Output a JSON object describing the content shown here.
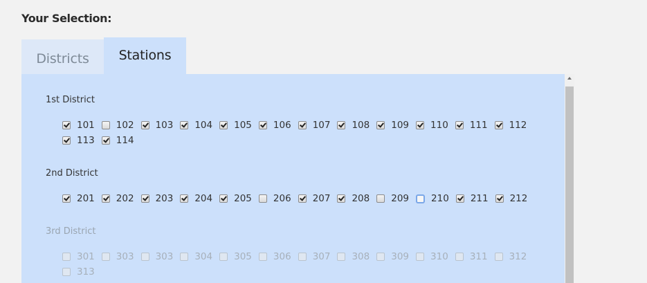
{
  "heading": "Your Selection:",
  "tabs": [
    {
      "label": "Districts",
      "active": false
    },
    {
      "label": "Stations",
      "active": true
    }
  ],
  "districts": [
    {
      "title": "1st District",
      "disabled": false,
      "stations": [
        {
          "label": "101",
          "checked": true
        },
        {
          "label": "102",
          "checked": false
        },
        {
          "label": "103",
          "checked": true
        },
        {
          "label": "104",
          "checked": true
        },
        {
          "label": "105",
          "checked": true
        },
        {
          "label": "106",
          "checked": true
        },
        {
          "label": "107",
          "checked": true
        },
        {
          "label": "108",
          "checked": true
        },
        {
          "label": "109",
          "checked": true
        },
        {
          "label": "110",
          "checked": true
        },
        {
          "label": "111",
          "checked": true
        },
        {
          "label": "112",
          "checked": true
        },
        {
          "label": "113",
          "checked": true
        },
        {
          "label": "114",
          "checked": true
        }
      ]
    },
    {
      "title": "2nd District",
      "disabled": false,
      "stations": [
        {
          "label": "201",
          "checked": true
        },
        {
          "label": "202",
          "checked": true
        },
        {
          "label": "203",
          "checked": true
        },
        {
          "label": "204",
          "checked": true
        },
        {
          "label": "205",
          "checked": true
        },
        {
          "label": "206",
          "checked": false
        },
        {
          "label": "207",
          "checked": true
        },
        {
          "label": "208",
          "checked": true
        },
        {
          "label": "209",
          "checked": false
        },
        {
          "label": "210",
          "checked": false,
          "focused": true
        },
        {
          "label": "211",
          "checked": true
        },
        {
          "label": "212",
          "checked": true
        }
      ]
    },
    {
      "title": "3rd District",
      "disabled": true,
      "stations": [
        {
          "label": "301",
          "checked": false
        },
        {
          "label": "303",
          "checked": false
        },
        {
          "label": "303",
          "checked": false
        },
        {
          "label": "304",
          "checked": false
        },
        {
          "label": "305",
          "checked": false
        },
        {
          "label": "306",
          "checked": false
        },
        {
          "label": "307",
          "checked": false
        },
        {
          "label": "308",
          "checked": false
        },
        {
          "label": "309",
          "checked": false
        },
        {
          "label": "310",
          "checked": false
        },
        {
          "label": "311",
          "checked": false
        },
        {
          "label": "312",
          "checked": false
        },
        {
          "label": "313",
          "checked": false
        }
      ]
    }
  ]
}
